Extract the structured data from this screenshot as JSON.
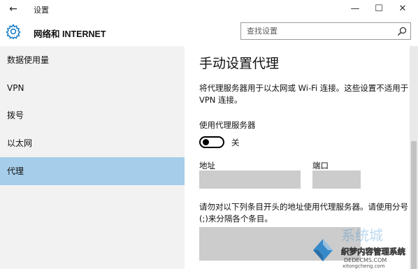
{
  "window": {
    "back_glyph": "←",
    "title": "设置",
    "minimize_glyph": "—",
    "maximize_glyph": "☐",
    "close_glyph": "✕"
  },
  "header": {
    "title": "网络和 INTERNET",
    "icon": "gear-icon"
  },
  "search": {
    "placeholder": "查找设置",
    "icon": "search-icon"
  },
  "sidebar": {
    "items": [
      {
        "label": "数据使用量",
        "active": false
      },
      {
        "label": "VPN",
        "active": false
      },
      {
        "label": "拨号",
        "active": false
      },
      {
        "label": "以太网",
        "active": false
      },
      {
        "label": "代理",
        "active": true
      }
    ]
  },
  "main": {
    "section_title": "手动设置代理",
    "description": "将代理服务器用于以太网或 Wi-Fi 连接。这些设置不适用于 VPN 连接。",
    "proxy_toggle": {
      "label": "使用代理服务器",
      "state_text": "关",
      "on": false
    },
    "address_label": "地址",
    "address_value": "",
    "port_label": "端口",
    "port_value": "",
    "exceptions_description": "请勿对以下列条目开头的地址使用代理服务器。请使用分号(;)来分隔各个条目。",
    "exceptions_value": ""
  },
  "watermark": {
    "line1": "系统城",
    "line2": "织梦内容管理系统",
    "line3": "DEDECMS.COM",
    "line4": "xitongcheng.com"
  },
  "colors": {
    "sidebar_bg": "#f2f2f2",
    "active_item_bg": "#a6cde9",
    "field_bg": "#cccccc",
    "accent": "#1e7fc8"
  }
}
